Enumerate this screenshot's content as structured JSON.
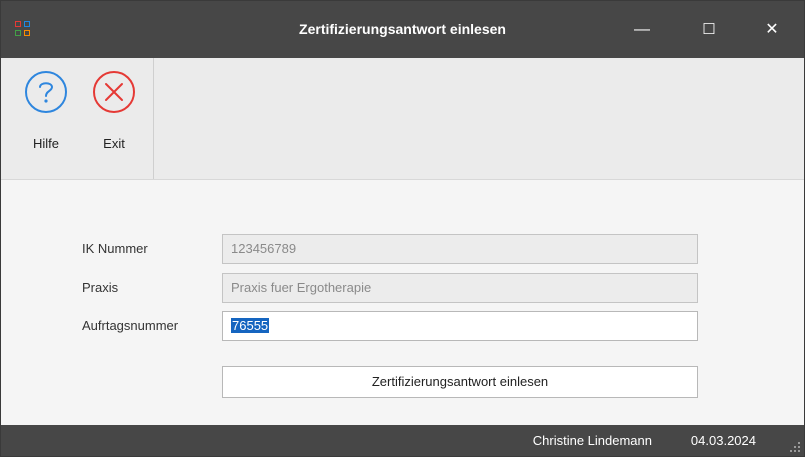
{
  "window": {
    "title": "Zertifizierungsantwort einlesen",
    "controls": {
      "minimize": "—",
      "maximize": "☐",
      "close": "✕"
    },
    "app_icon_colors": [
      "#e53935",
      "#1e88e5",
      "#43a047",
      "#fb8c00"
    ]
  },
  "ribbon": {
    "help": {
      "label": "Hilfe",
      "icon": "help-circle-icon",
      "color": "#2e86de"
    },
    "exit": {
      "label": "Exit",
      "icon": "close-circle-icon",
      "color": "#e53935"
    }
  },
  "form": {
    "ik_label": "IK Nummer",
    "ik_value": "123456789",
    "praxis_label": "Praxis",
    "praxis_value": "Praxis fuer Ergotherapie",
    "auftrag_label": "Aufrtagsnummer",
    "auftrag_value": "76555",
    "submit_label": "Zertifizierungsantwort einlesen"
  },
  "status": {
    "user": "Christine Lindemann",
    "date": "04.03.2024"
  },
  "colors": {
    "titlebar": "#474747",
    "selection": "#1565c0"
  }
}
